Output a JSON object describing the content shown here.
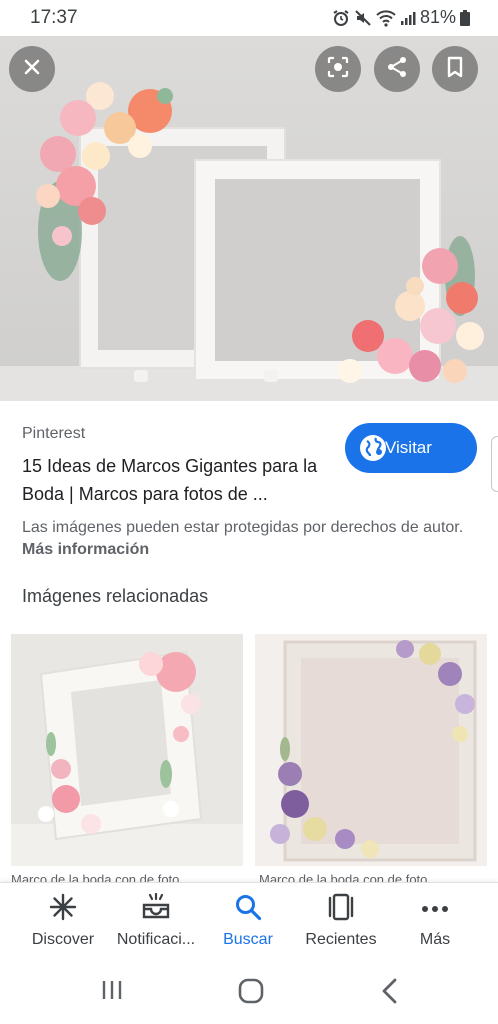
{
  "status_bar": {
    "time": "17:37",
    "battery": "81%",
    "icons": [
      "alarm-icon",
      "mute-icon",
      "wifi-icon",
      "signal-icon",
      "battery-icon"
    ]
  },
  "hero": {
    "buttons": [
      "close-icon",
      "lens-icon",
      "share-icon",
      "bookmark-icon"
    ]
  },
  "result": {
    "source": "Pinterest",
    "title": "15 Ideas de Marcos Gigantes para la Boda | Marcos para fotos de ...",
    "visit_label": "Visitar",
    "disclaimer_text": "Las imágenes pueden estar protegidas por derechos de autor.",
    "more_info": "Más información"
  },
  "related": {
    "heading": "Imágenes relacionadas",
    "items": [
      {
        "caption": "Marco de la boda con de foto"
      },
      {
        "caption": "Marco de la boda con de foto"
      }
    ]
  },
  "bottom_nav": {
    "items": [
      {
        "label": "Discover",
        "icon": "asterisk-icon"
      },
      {
        "label": "Notificaci...",
        "icon": "notifications-icon"
      },
      {
        "label": "Buscar",
        "icon": "search-icon"
      },
      {
        "label": "Recientes",
        "icon": "recents-icon"
      },
      {
        "label": "Más",
        "icon": "more-icon"
      }
    ]
  },
  "colors": {
    "accent": "#1a73e8",
    "text_primary": "#202124",
    "text_secondary": "#5f6368"
  }
}
